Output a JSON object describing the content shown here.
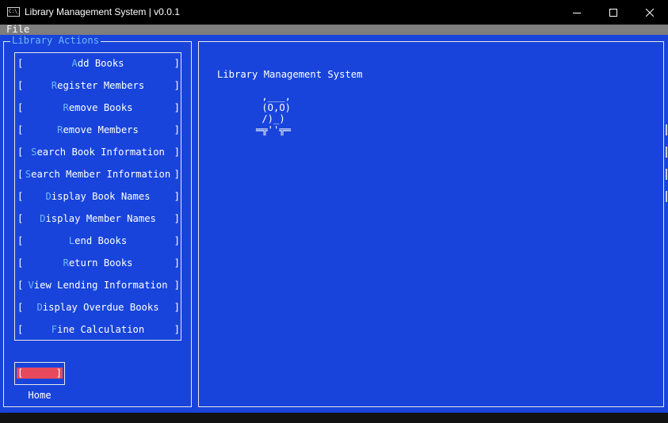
{
  "window": {
    "title": "Library Management System | v0.0.1",
    "icon_text": "C:\\_",
    "controls": [
      "minimize-icon",
      "maximize-icon",
      "close-icon"
    ]
  },
  "menubar": {
    "file_label": "File"
  },
  "sidebar": {
    "title": "Library Actions",
    "items": [
      {
        "hotkey": "A",
        "rest": "dd Books"
      },
      {
        "hotkey": "R",
        "rest": "egister Members"
      },
      {
        "hotkey": "R",
        "rest": "emove Books"
      },
      {
        "hotkey": "R",
        "rest": "emove Members"
      },
      {
        "hotkey": "S",
        "rest": "earch Book Information"
      },
      {
        "hotkey": "S",
        "rest": "earch Member Information"
      },
      {
        "hotkey": "D",
        "rest": "isplay Book Names"
      },
      {
        "hotkey": "D",
        "rest": "isplay Member Names"
      },
      {
        "hotkey": "L",
        "rest": "end Books"
      },
      {
        "hotkey": "R",
        "rest": "eturn Books"
      },
      {
        "hotkey": "V",
        "rest": "iew Lending Information"
      },
      {
        "hotkey": "D",
        "rest": "isplay Overdue Books"
      },
      {
        "hotkey": "F",
        "rest": "ine Calculation"
      }
    ],
    "bracket_open": "[",
    "bracket_close": "]",
    "home_label": "Home"
  },
  "main": {
    "title": "Library Management System",
    "ascii_art": " ,___,\n (O,O)\n /)_)\n═╦''╦═"
  },
  "colors": {
    "background": "#1844db",
    "hotkey": "#6fb8ff",
    "home_button": "#e8495c",
    "menubar": "#7e7e7e",
    "titlebar": "#000000"
  }
}
